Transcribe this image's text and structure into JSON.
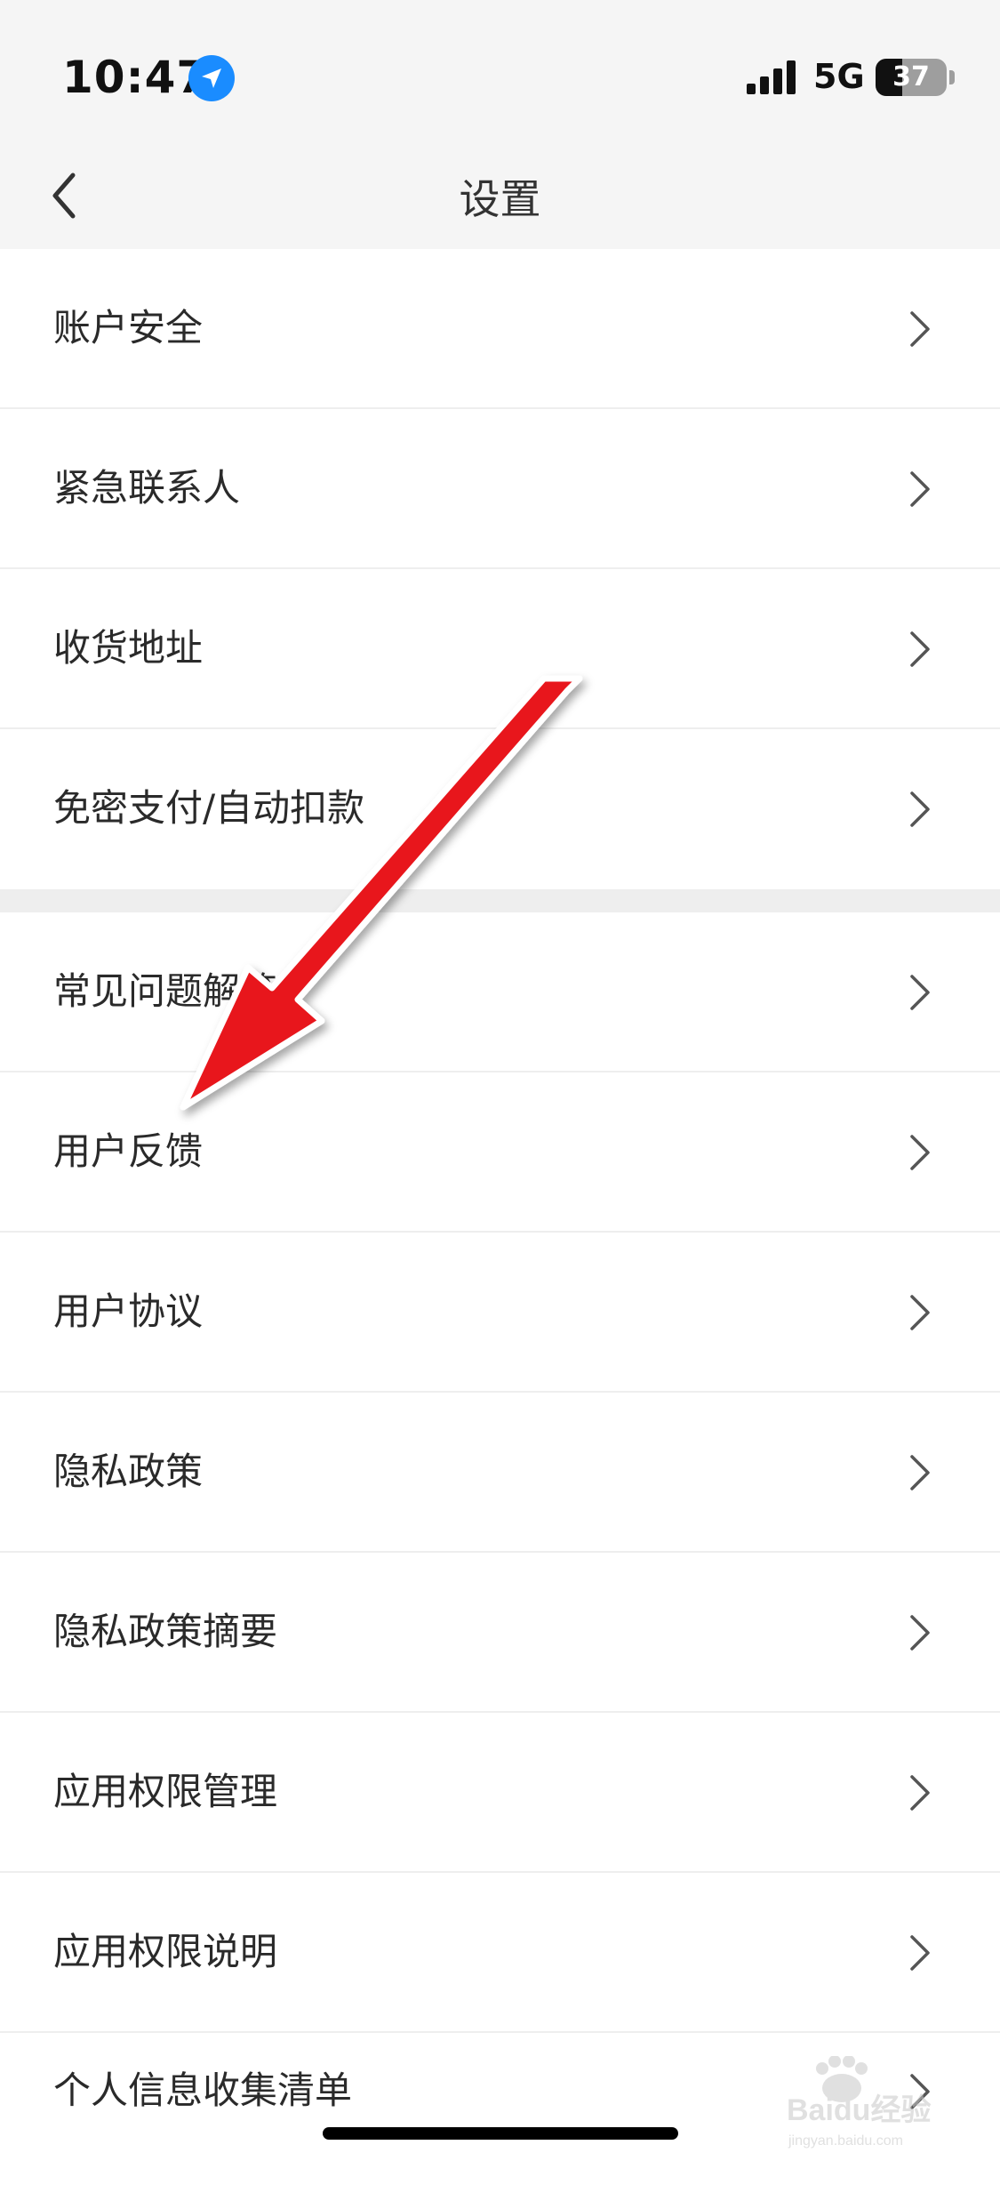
{
  "status_bar": {
    "time": "10:47",
    "network": "5G",
    "battery": "37",
    "battery_level": 0.37
  },
  "nav": {
    "title": "设置"
  },
  "section1": {
    "items": [
      {
        "label": "账户安全"
      },
      {
        "label": "紧急联系人"
      },
      {
        "label": "收货地址"
      },
      {
        "label": "免密支付/自动扣款"
      }
    ]
  },
  "section2": {
    "items": [
      {
        "label": "常见问题解答"
      },
      {
        "label": "用户反馈"
      },
      {
        "label": "用户协议"
      },
      {
        "label": "隐私政策"
      },
      {
        "label": "隐私政策摘要"
      },
      {
        "label": "应用权限管理"
      },
      {
        "label": "应用权限说明"
      },
      {
        "label": "个人信息收集清单"
      }
    ]
  },
  "watermark": {
    "text": "Baidu经验",
    "subtext": "jingyan.baidu.com"
  },
  "colors": {
    "arrow": "#e8141b",
    "location": "#1a8cff",
    "header_bg": "#f5f5f5",
    "divider": "#eeeeee"
  },
  "icons": [
    "location-arrow-icon",
    "signal-icon",
    "battery-icon",
    "back-chevron-icon",
    "chevron-right-icon",
    "annotation-arrow",
    "baidu-paw-icon"
  ]
}
